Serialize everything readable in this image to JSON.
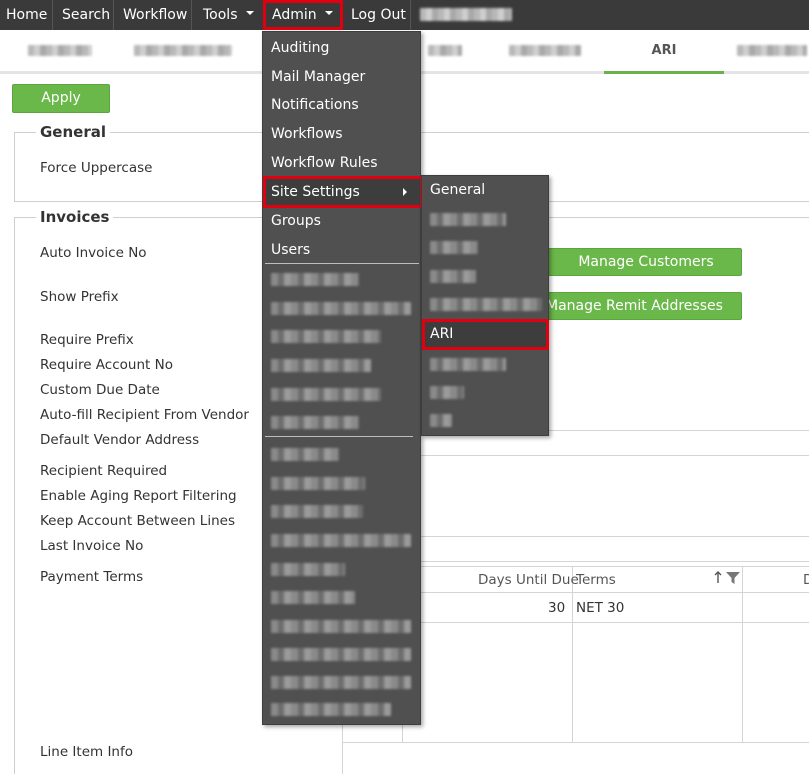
{
  "nav": {
    "home": "Home",
    "search": "Search",
    "workflow": "Workflow",
    "tools": "Tools",
    "admin": "Admin",
    "logout": "Log Out"
  },
  "tabs": {
    "active_label": "ARI"
  },
  "apply_label": "Apply",
  "general": {
    "legend": "General",
    "force_uppercase": "Force Uppercase"
  },
  "invoices": {
    "legend": "Invoices",
    "labels": {
      "auto_invoice_no": "Auto Invoice No",
      "show_prefix": "Show Prefix",
      "require_prefix": "Require Prefix",
      "require_account_no": "Require Account No",
      "custom_due_date": "Custom Due Date",
      "auto_fill_recipient": "Auto-fill Recipient From Vendor",
      "default_vendor_address": "Default Vendor Address",
      "recipient_required": "Recipient Required",
      "enable_aging": "Enable Aging Report Filtering",
      "keep_account": "Keep Account Between Lines",
      "last_invoice_no": "Last Invoice No",
      "payment_terms": "Payment Terms",
      "line_item_info": "Line Item Info"
    },
    "manage_customers": "Manage Customers",
    "manage_remit": "Manage Remit Addresses"
  },
  "payment_terms_grid": {
    "columns": [
      "Days Until Due",
      "Terms"
    ],
    "rows": [
      {
        "days": "30",
        "terms": "NET 30"
      }
    ]
  },
  "admin_menu": {
    "items": [
      "Auditing",
      "Mail Manager",
      "Notifications",
      "Workflows",
      "Workflow Rules",
      "Site Settings",
      "Groups",
      "Users"
    ]
  },
  "site_settings_menu": {
    "items": [
      "General",
      "ARI"
    ]
  },
  "colors": {
    "nav_bg": "#3a3a3a",
    "menu_bg": "#505050",
    "accent_green": "#6bb84a",
    "highlight_red": "#e0000f"
  }
}
